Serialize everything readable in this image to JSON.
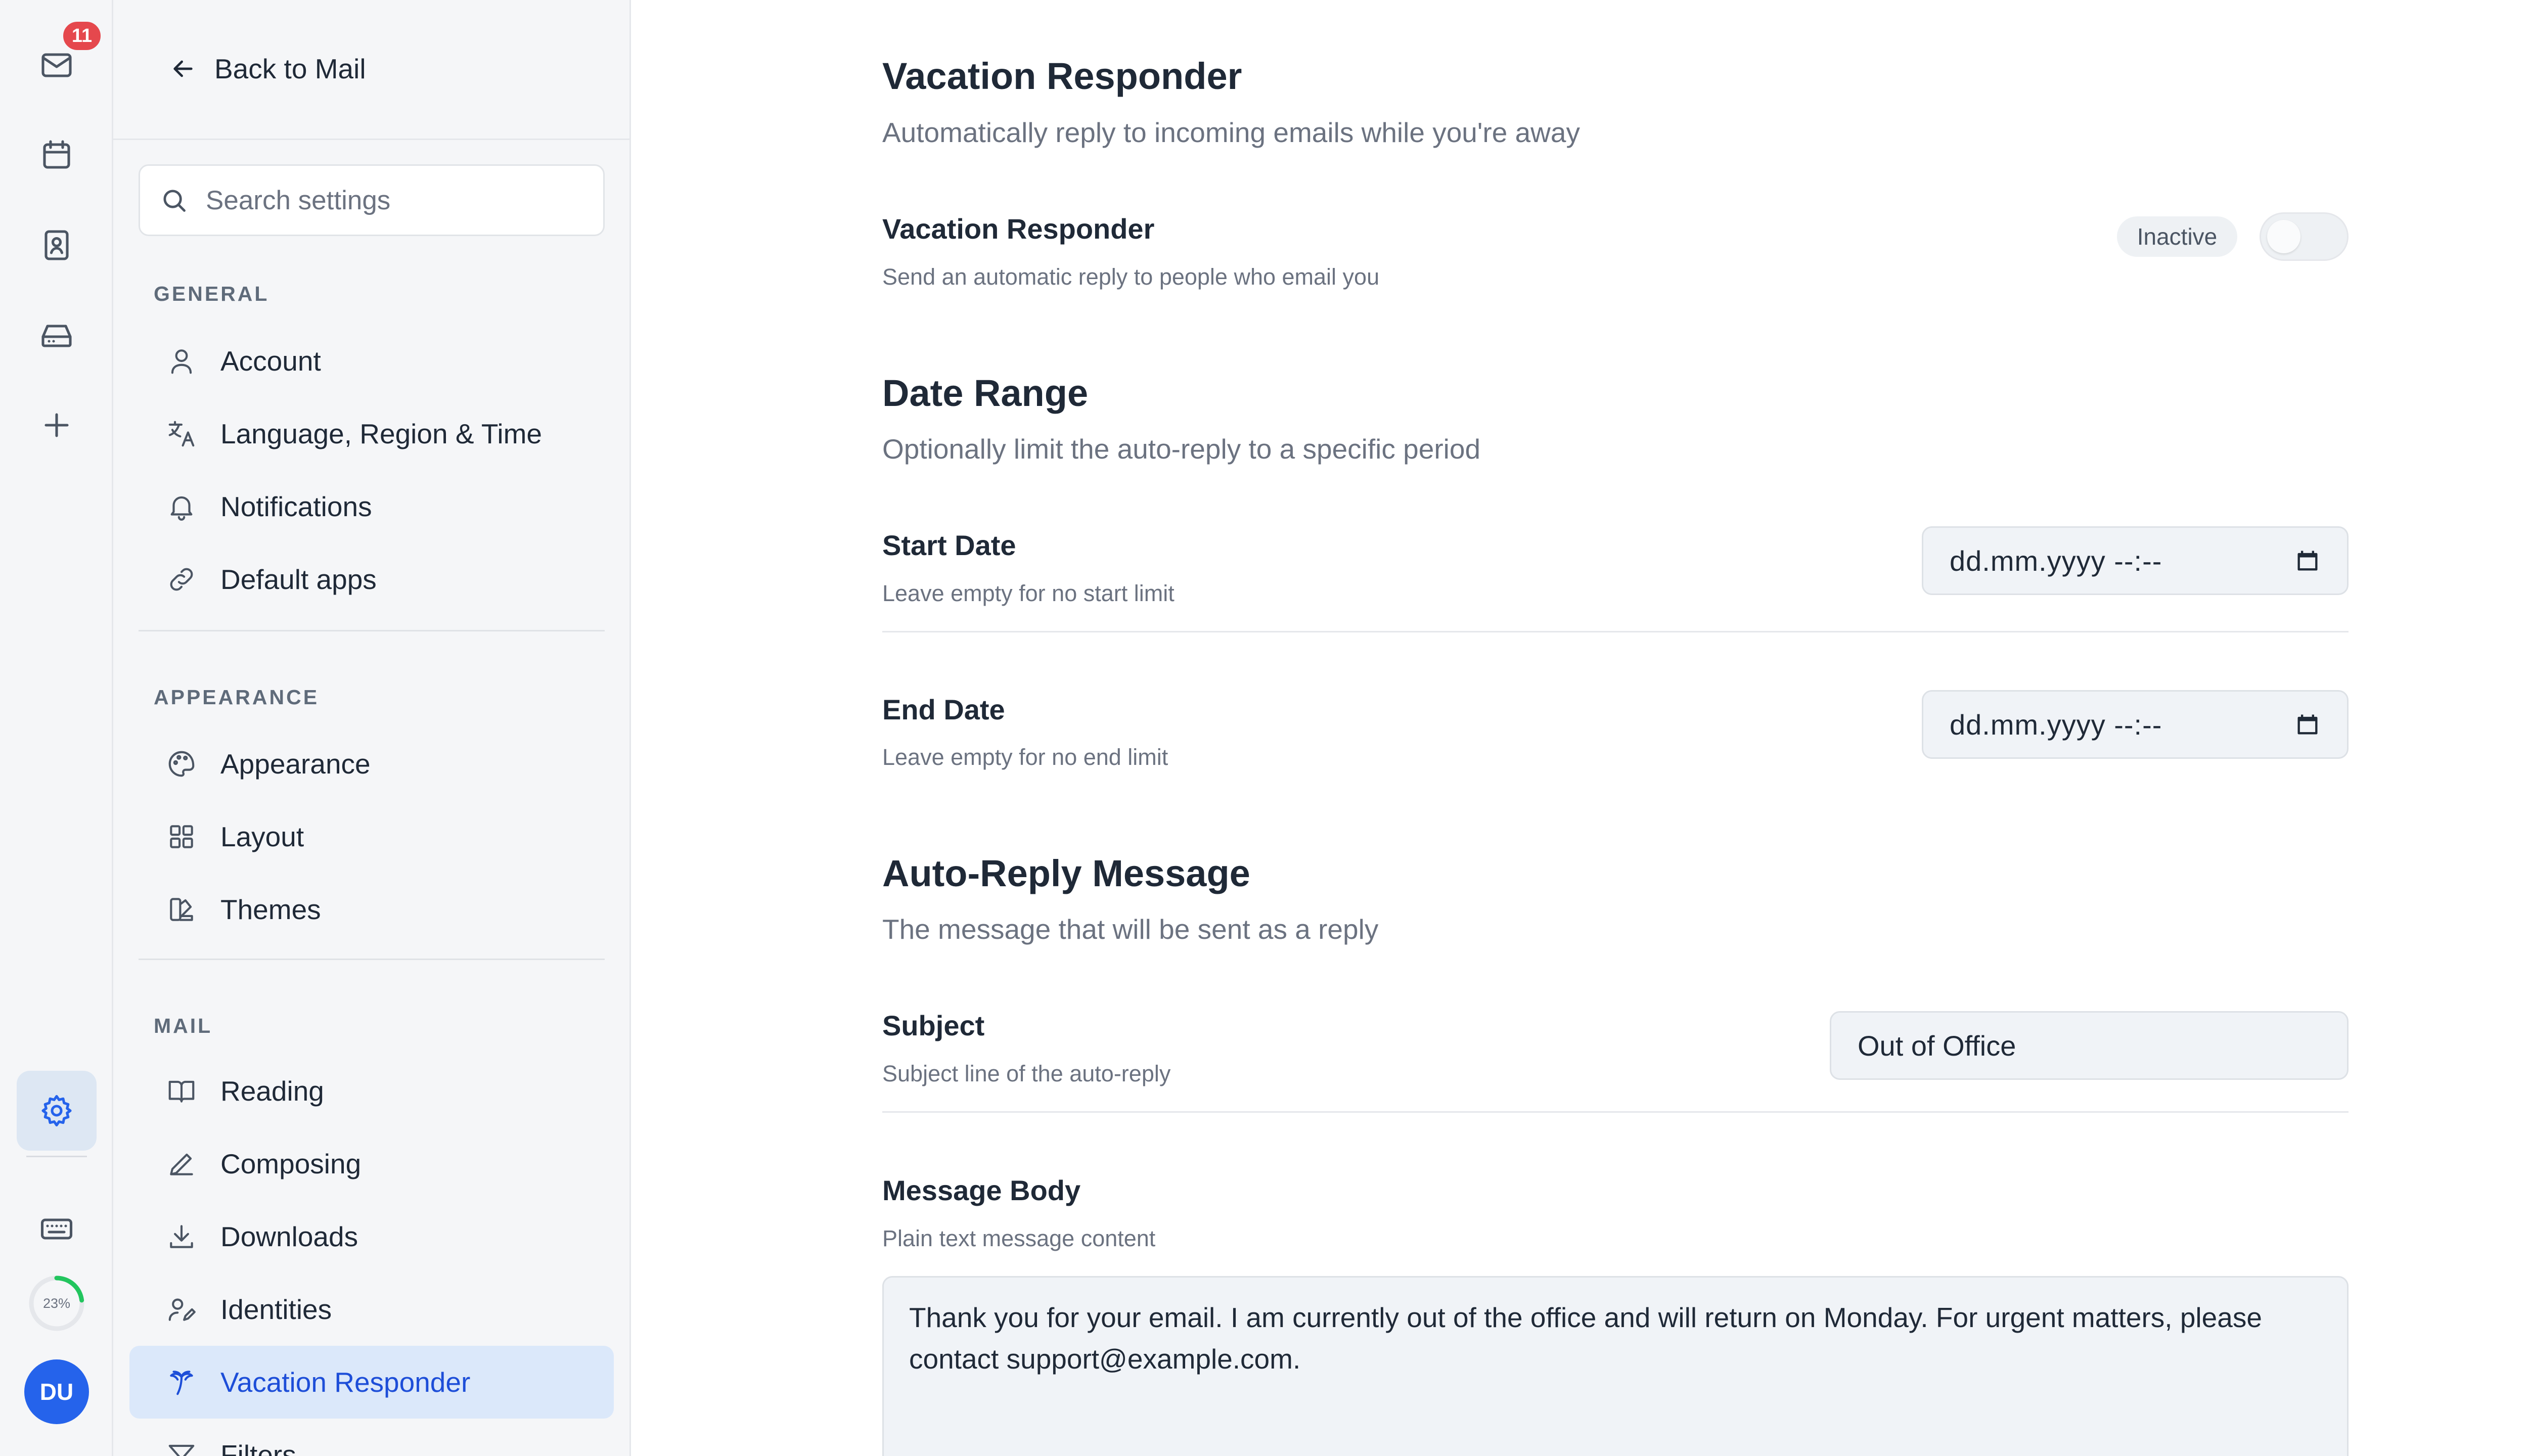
{
  "rail": {
    "mail_badge": "11",
    "storage_percent": "23%",
    "storage_fraction": 0.23,
    "avatar_initials": "DU",
    "icons": [
      "mail-icon",
      "calendar-icon",
      "contacts-icon",
      "inbox-tray-icon",
      "plus-icon",
      "gear-icon",
      "keyboard-icon"
    ]
  },
  "sidebar": {
    "back_label": "Back to Mail",
    "search_placeholder": "Search settings",
    "sections": [
      {
        "label": "GENERAL",
        "items": [
          {
            "label": "Account",
            "icon": "user-icon"
          },
          {
            "label": "Language, Region & Time",
            "icon": "translate-icon"
          },
          {
            "label": "Notifications",
            "icon": "bell-icon"
          },
          {
            "label": "Default apps",
            "icon": "link-icon"
          }
        ]
      },
      {
        "label": "APPEARANCE",
        "items": [
          {
            "label": "Appearance",
            "icon": "palette-icon"
          },
          {
            "label": "Layout",
            "icon": "grid-icon"
          },
          {
            "label": "Themes",
            "icon": "swatch-icon"
          }
        ]
      },
      {
        "label": "MAIL",
        "items": [
          {
            "label": "Reading",
            "icon": "book-icon"
          },
          {
            "label": "Composing",
            "icon": "pen-icon"
          },
          {
            "label": "Downloads",
            "icon": "download-icon"
          },
          {
            "label": "Identities",
            "icon": "identity-icon"
          },
          {
            "label": "Vacation Responder",
            "icon": "palm-tree-icon",
            "active": true
          },
          {
            "label": "Filters",
            "icon": "filter-icon"
          }
        ]
      }
    ]
  },
  "main": {
    "vacation": {
      "title": "Vacation Responder",
      "subtitle": "Automatically reply to incoming emails while you're away",
      "row_title": "Vacation Responder",
      "row_sub": "Send an automatic reply to people who email you",
      "status": "Inactive",
      "enabled": false
    },
    "date_range": {
      "title": "Date Range",
      "subtitle": "Optionally limit the auto-reply to a specific period",
      "start_title": "Start Date",
      "start_sub": "Leave empty for no start limit",
      "start_value": "dd.mm.yyyy  --:--",
      "end_title": "End Date",
      "end_sub": "Leave empty for no end limit",
      "end_value": "dd.mm.yyyy  --:--"
    },
    "auto_reply": {
      "title": "Auto-Reply Message",
      "subtitle": "The message that will be sent as a reply",
      "subject_title": "Subject",
      "subject_sub": "Subject line of the auto-reply",
      "subject_value": "Out of Office",
      "body_title": "Message Body",
      "body_sub": "Plain text message content",
      "body_value": "Thank you for your email. I am currently out of the office and will return on Monday. For urgent matters, please contact support@example.com."
    }
  },
  "colors": {
    "accent": "#2563eb",
    "active_bg": "#dbe8fa",
    "badge": "#e5484d",
    "storage_ring": "#22c55e"
  }
}
